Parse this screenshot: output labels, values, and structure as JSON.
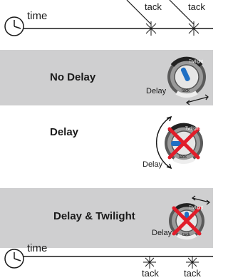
{
  "top_timeline": {
    "label": "time",
    "tacks": [
      "tack",
      "tack"
    ]
  },
  "rows": [
    {
      "title": "No Delay",
      "dial_label": "Delay",
      "dial_top_label": "Twilight",
      "dial_bottom_label": "tack",
      "crossed": false
    },
    {
      "title": "Delay",
      "dial_label": "Delay",
      "dial_top_label": "Twilight",
      "dial_bottom_label": "tack",
      "crossed": true
    },
    {
      "title": "Delay & Twilight",
      "dial_label": "Delay",
      "dial_top_label": "Twilight",
      "dial_bottom_label": "tack",
      "crossed": true
    }
  ],
  "bottom_timeline": {
    "label": "time",
    "tacks": [
      "tack",
      "tack"
    ]
  },
  "colors": {
    "band_gray": "#cfcfd0",
    "cross": "#e11d2a",
    "indicator": "#1f6fc4",
    "line": "#1a1a1a"
  }
}
